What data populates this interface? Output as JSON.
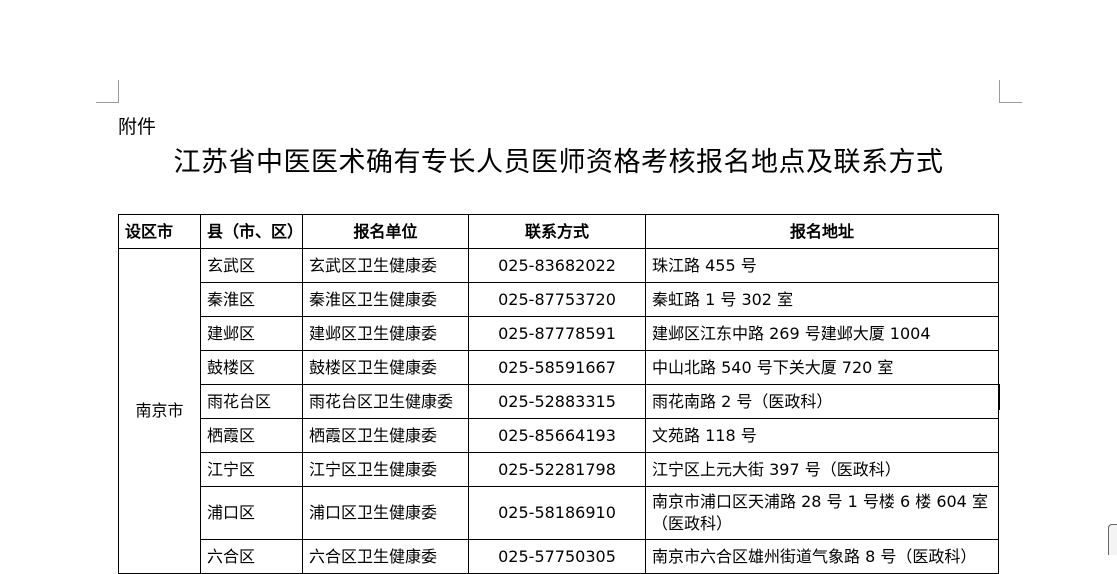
{
  "doc": {
    "attachment_label": "附件",
    "title": "江苏省中医医术确有专长人员医师资格考核报名地点及联系方式"
  },
  "table": {
    "headers": [
      "设区市",
      "县（市、区）",
      "报名单位",
      "联系方式",
      "报名地址"
    ],
    "city": "南京市",
    "rows": [
      {
        "county": "玄武区",
        "unit": "玄武区卫生健康委",
        "phone": "025-83682022",
        "address": "珠江路 455 号"
      },
      {
        "county": "秦淮区",
        "unit": "秦淮区卫生健康委",
        "phone": "025-87753720",
        "address": "秦虹路 1 号 302 室"
      },
      {
        "county": "建邺区",
        "unit": "建邺区卫生健康委",
        "phone": "025-87778591",
        "address": "建邺区江东中路 269 号建邺大厦 1004"
      },
      {
        "county": "鼓楼区",
        "unit": "鼓楼区卫生健康委",
        "phone": "025-58591667",
        "address": "中山北路 540 号下关大厦 720 室"
      },
      {
        "county": "雨花台区",
        "unit": "雨花台区卫生健康委",
        "phone": "025-52883315",
        "address": "雨花南路 2 号（医政科）"
      },
      {
        "county": "栖霞区",
        "unit": "栖霞区卫生健康委",
        "phone": "025-85664193",
        "address": "文苑路 118 号"
      },
      {
        "county": "江宁区",
        "unit": "江宁区卫生健康委",
        "phone": "025-52281798",
        "address": "江宁区上元大街 397 号（医政科）"
      },
      {
        "county": "浦口区",
        "unit": "浦口区卫生健康委",
        "phone": "025-58186910",
        "address": "南京市浦口区天浦路 28 号 1 号楼 6 楼 604 室（医政科）"
      },
      {
        "county": "六合区",
        "unit": "六合区卫生健康委",
        "phone": "025-57750305",
        "address": "南京市六合区雄州街道气象路 8 号（医政科）"
      }
    ]
  }
}
